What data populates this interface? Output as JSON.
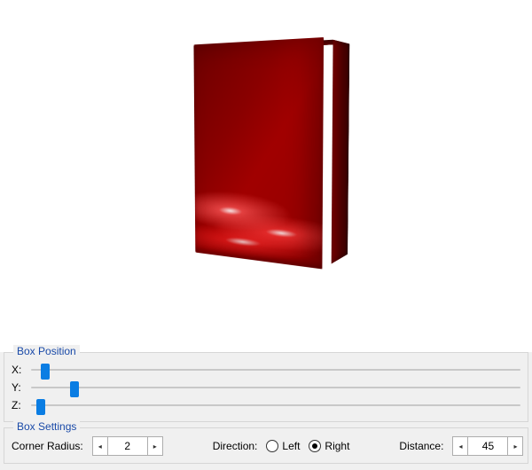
{
  "preview": {
    "box_color": "#8a0000"
  },
  "boxPosition": {
    "title": "Box Position",
    "sliders": [
      {
        "label": "X:",
        "value_pct": 2
      },
      {
        "label": "Y:",
        "value_pct": 8
      },
      {
        "label": "Z:",
        "value_pct": 1
      }
    ]
  },
  "boxSettings": {
    "title": "Box Settings",
    "cornerRadius": {
      "label": "Corner Radius:",
      "value": 2
    },
    "direction": {
      "label": "Direction:",
      "options": {
        "left": "Left",
        "right": "Right"
      },
      "selected": "right"
    },
    "distance": {
      "label": "Distance:",
      "value": 45
    }
  }
}
